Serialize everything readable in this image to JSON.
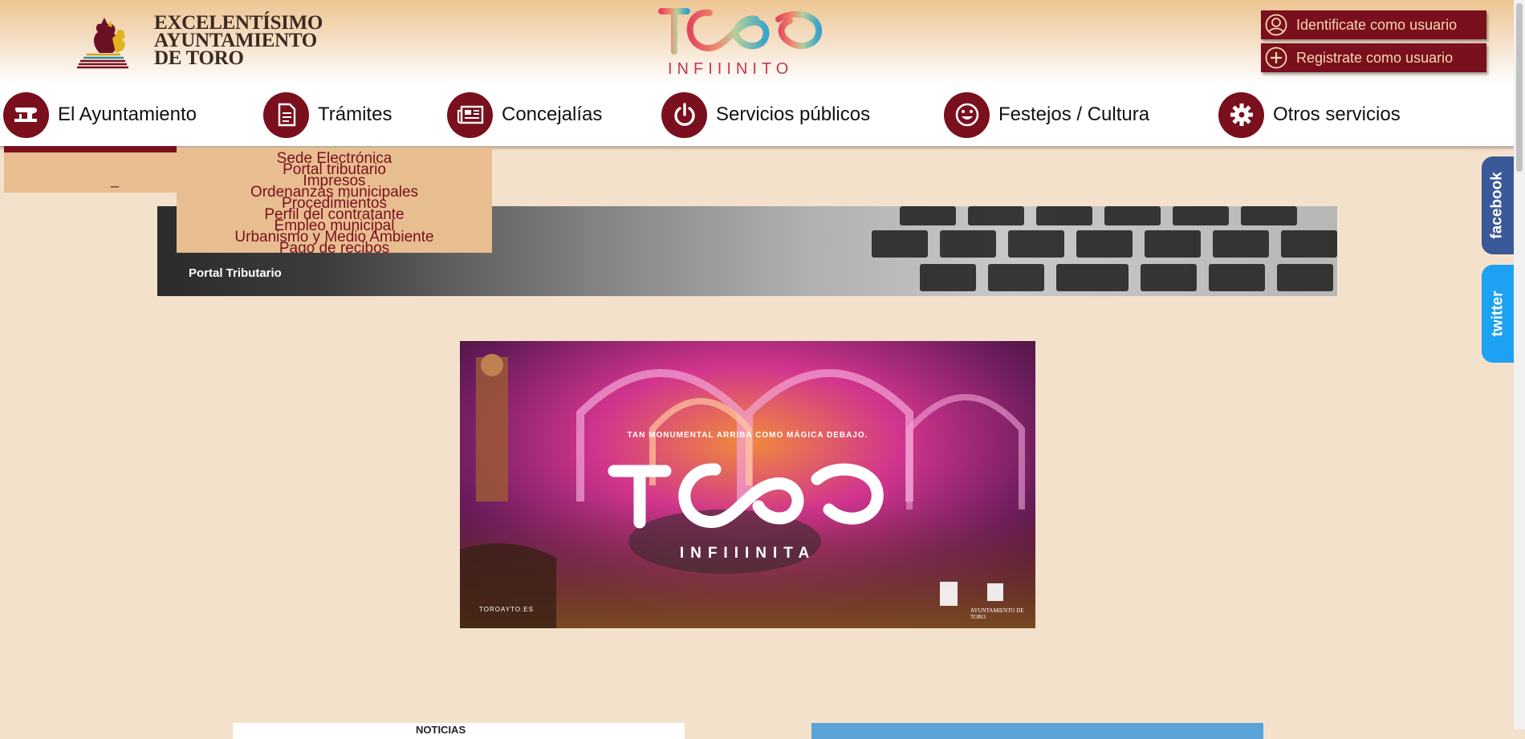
{
  "header": {
    "council_name_lines": [
      "EXCELENTÍSIMO",
      "AYUNTAMIENTO",
      "DE TORO"
    ],
    "brand_wordmark": "TORO",
    "brand_subtitle": "INFIIINITO",
    "login_label": "Identificate como usuario",
    "register_label": "Registrate como usuario"
  },
  "nav": {
    "items": [
      {
        "label": "El Ayuntamiento",
        "icon": "sewing-machine-icon"
      },
      {
        "label": "Trámites",
        "icon": "document-icon"
      },
      {
        "label": "Concejalías",
        "icon": "newspaper-icon"
      },
      {
        "label": "Servicios públicos",
        "icon": "power-icon"
      },
      {
        "label": "Festejos / Cultura",
        "icon": "smiley-icon"
      },
      {
        "label": "Otros servicios",
        "icon": "gear-icon"
      }
    ]
  },
  "dropdown": {
    "left_dash": "_",
    "items": [
      "Sede Electrónica",
      "Portal tributario",
      "Impresos",
      "Ordenanzas municipales",
      "Procedimientos",
      "Perfil del contratante",
      "Empleo municipal",
      "Urbanismo y Medio Ambiente",
      "Pago de recibos"
    ]
  },
  "banner": {
    "title": "Portal Tributario"
  },
  "promo": {
    "tagline": "TAN MONUMENTAL ARRIBA COMO MÁGICA DEBAJO.",
    "wordmark": "TORO",
    "subtitle": "INFIIINITA",
    "url": "TOROAYTO.ES",
    "logo_right": "AYUNTAMIENTO DE TORO",
    "logo_left": "TORO"
  },
  "bottom": {
    "left_card_title": "NOTICIAS"
  },
  "social": {
    "facebook": "facebook",
    "twitter": "twitter"
  },
  "colors": {
    "brand": "#7a0f1e",
    "background": "#f4e1cb",
    "menu_bg": "#e8be91",
    "facebook": "#3b5998",
    "twitter": "#1da1f2"
  }
}
